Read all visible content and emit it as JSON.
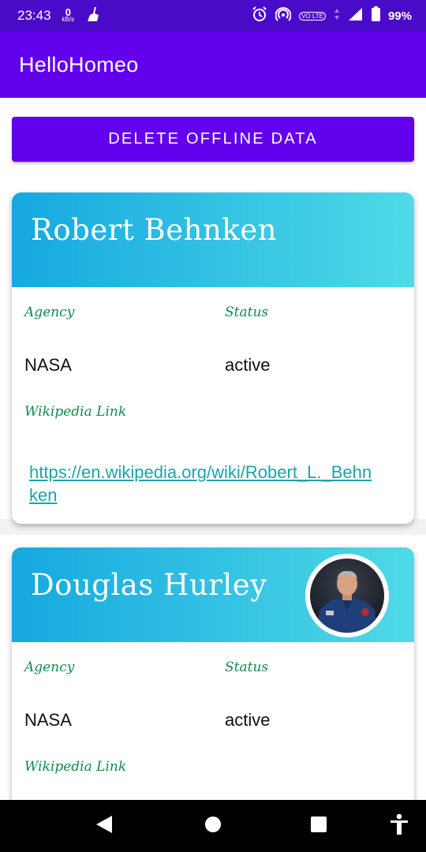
{
  "status_bar": {
    "time": "23:43",
    "net_speed_value": "0",
    "net_speed_unit": "kB/s",
    "volte_label": "VO LTE",
    "battery_percent": "99%"
  },
  "app_bar": {
    "title": "HelloHomeo"
  },
  "actions": {
    "delete_label": "DELETE OFFLINE DATA"
  },
  "crew": [
    {
      "name": "Robert Behnken",
      "agency_label": "Agency",
      "agency": "NASA",
      "status_label": "Status",
      "status": "active",
      "wiki_label": "Wikipedia Link",
      "wikipedia": "https://en.wikipedia.org/wiki/Robert_L._Behnken",
      "has_photo": false
    },
    {
      "name": "Douglas Hurley",
      "agency_label": "Agency",
      "agency": "NASA",
      "status_label": "Status",
      "status": "active",
      "wiki_label": "Wikipedia Link",
      "has_photo": true
    }
  ],
  "colors": {
    "status_bar": "#4a0bc9",
    "primary": "#6200ee",
    "header_gradient_start": "#16a8e0",
    "header_gradient_end": "#4fdae6",
    "label_green": "#128a4e",
    "link_teal": "#1aa5a8"
  },
  "icons": {
    "status_left": [
      "cleaner-icon"
    ],
    "status_right": [
      "alarm-icon",
      "hotspot-icon",
      "volte-icon",
      "data-arrows-icon",
      "signal-icon",
      "battery-icon"
    ],
    "nav": [
      "back-icon",
      "home-icon",
      "recents-icon",
      "accessibility-icon"
    ]
  }
}
